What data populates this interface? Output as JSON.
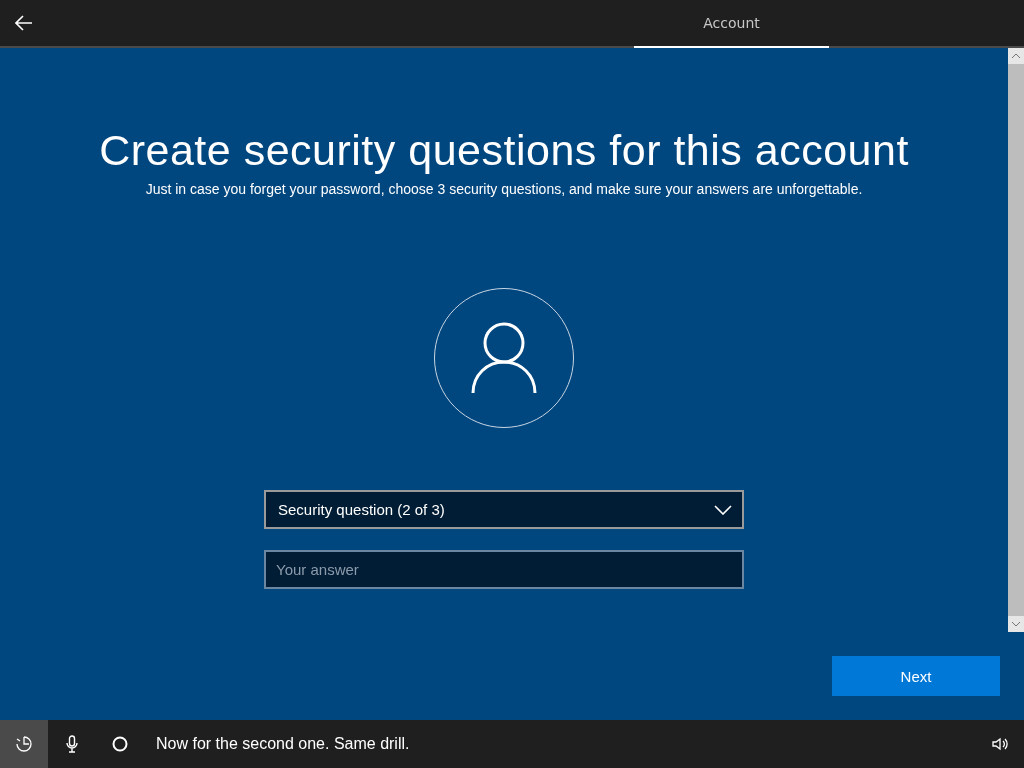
{
  "tabs": [
    {
      "label": "Account",
      "selected": true
    }
  ],
  "title": "Create security questions for this account",
  "subtitle": "Just in case you forget your password, choose 3 security questions, and make sure your answers are unforgettable.",
  "question_dropdown": {
    "value": "Security question (2 of 3)"
  },
  "answer_field": {
    "placeholder": "Your answer"
  },
  "next_button": "Next",
  "status_bar": {
    "message": "Now for the second one. Same drill."
  }
}
